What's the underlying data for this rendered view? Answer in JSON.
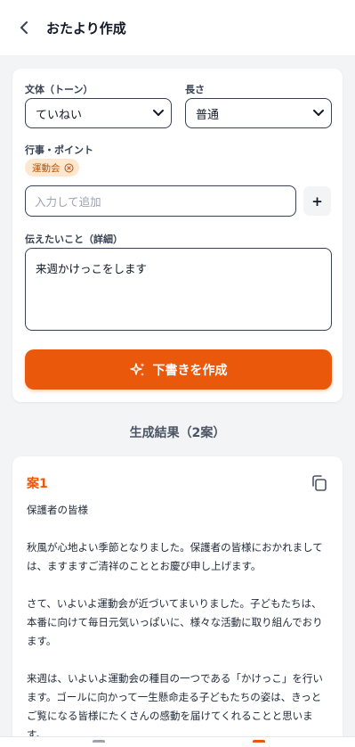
{
  "header": {
    "title": "おたより作成"
  },
  "form": {
    "tone_label": "文体（トーン）",
    "tone_value": "ていねい",
    "length_label": "長さ",
    "length_value": "普通",
    "points_label": "行事・ポイント",
    "chips": [
      "運動会"
    ],
    "add_placeholder": "入力して追加",
    "add_button": "+",
    "details_label": "伝えたいこと（詳細）",
    "details_value": "来週かけっこをします",
    "generate_label": "下書きを作成"
  },
  "results": {
    "title": "生成結果（2案）",
    "drafts": [
      {
        "title": "案1",
        "greeting": "保護者の皆様",
        "p1": "秋風が心地よい季節となりました。保護者の皆様におかれましては、ますますご清祥のこととお慶び申し上げます。",
        "p2": "さて、いよいよ運動会が近づいてまいりました。子どもたちは、本番に向けて毎日元気いっぱいに、様々な活動に取り組んでおります。",
        "p3": "来週は、いよいよ運動会の種目の一つである「かけっこ」を行います。ゴールに向かって一生懸命走る子どもたちの姿は、きっとご覧になる皆様にたくさんの感動を届けてくれることと思います。"
      }
    ]
  },
  "colors": {
    "accent": "#ea580c",
    "chip_bg": "#fde7cf",
    "chip_text": "#b45309"
  }
}
